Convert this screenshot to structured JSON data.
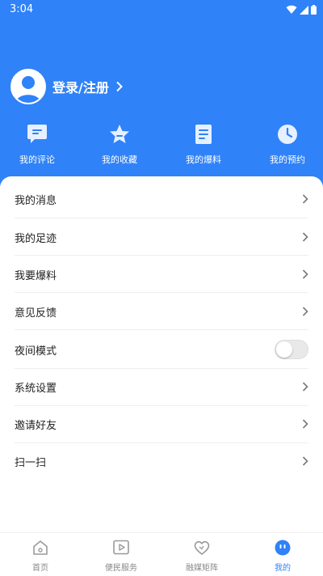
{
  "status_bar": {
    "time": "3:04"
  },
  "profile": {
    "login_label": "登录/注册"
  },
  "quick_actions": [
    {
      "label": "我的评论",
      "icon": "comment-icon"
    },
    {
      "label": "我的收藏",
      "icon": "star-icon"
    },
    {
      "label": "我的爆料",
      "icon": "document-icon"
    },
    {
      "label": "我的预约",
      "icon": "clock-icon"
    }
  ],
  "menu": [
    {
      "label": "我的消息"
    },
    {
      "label": "我的足迹"
    },
    {
      "label": "我要爆料"
    },
    {
      "label": "意见反馈"
    },
    {
      "label": "夜间模式",
      "toggle": false
    },
    {
      "label": "系统设置"
    },
    {
      "label": "邀请好友"
    },
    {
      "label": "扫一扫"
    }
  ],
  "tabs": [
    {
      "label": "首页",
      "icon": "home-icon",
      "active": false
    },
    {
      "label": "便民服务",
      "icon": "video-play-icon",
      "active": false
    },
    {
      "label": "融媒矩阵",
      "icon": "heart-icon",
      "active": false
    },
    {
      "label": "我的",
      "icon": "profile-face-icon",
      "active": true
    }
  ],
  "colors": {
    "accent": "#2f82f8",
    "background": "#ffffff",
    "muted": "#888888"
  }
}
